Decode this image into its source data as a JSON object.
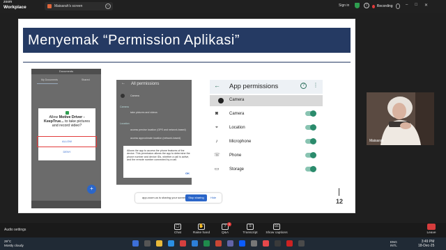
{
  "zoom": {
    "brand_top": "zoom",
    "brand_bottom": "Workplace",
    "share_tab": "Maisarah's screen",
    "sign_in": "Sign in",
    "recording": "Recording"
  },
  "slide": {
    "title": "Menyemak “Permission Aplikasi”",
    "page_number": "12",
    "phone1": {
      "header": "Documents",
      "tab_left": "My Documents",
      "tab_right": "Shared",
      "dialog_text_1": "Allow ",
      "dialog_app": "Motive Driver - KeepTrue...",
      "dialog_text_2": " to take pictures and record video?",
      "allow": "ALLOW",
      "deny": "DENY",
      "fab": "+"
    },
    "phone2": {
      "title": "All permissions",
      "camera": "Camera",
      "section_camera": "Camera",
      "take_pictures": "take pictures and videos",
      "section_location": "Location",
      "precise_location": "access precise location (GPS and network-based)",
      "approx_location": "access approximate location (network-based)",
      "dialog": "Allows the app to access the phone features of the device. This permission allows the app to determine the phone number and device IDs, whether a call is active, and the remote number connected by a call.",
      "ok": "OK"
    },
    "phone3": {
      "title": "App permissions",
      "camera_header": "Camera",
      "rows": [
        {
          "label": "Camera",
          "icon": "camera-icon",
          "on": true
        },
        {
          "label": "Location",
          "icon": "location-icon",
          "on": true
        },
        {
          "label": "Microphone",
          "icon": "microphone-icon",
          "on": true
        },
        {
          "label": "Phone",
          "icon": "phone-icon",
          "on": true
        },
        {
          "label": "Storage",
          "icon": "folder-icon",
          "on": true
        }
      ]
    },
    "share_pill": {
      "text": "app.zoom.us is sharing your screen.",
      "stop": "Stop sharing",
      "hide": "Hide"
    }
  },
  "video": {
    "name": "Maisarah"
  },
  "toolbar": {
    "audio_settings": "Audio settings",
    "buttons": [
      {
        "label": "Chat"
      },
      {
        "label": "Raise hand"
      },
      {
        "label": "Q&A",
        "badge": "1"
      },
      {
        "label": "Transcript"
      },
      {
        "label": "Show captions"
      }
    ],
    "leave": "Leave"
  },
  "taskbar": {
    "weather_temp": "29°C",
    "weather_desc": "Mostly cloudy",
    "lang_top": "ENG",
    "lang_bottom": "INTL",
    "time": "3:49 PM",
    "date": "18-Dec-25"
  }
}
